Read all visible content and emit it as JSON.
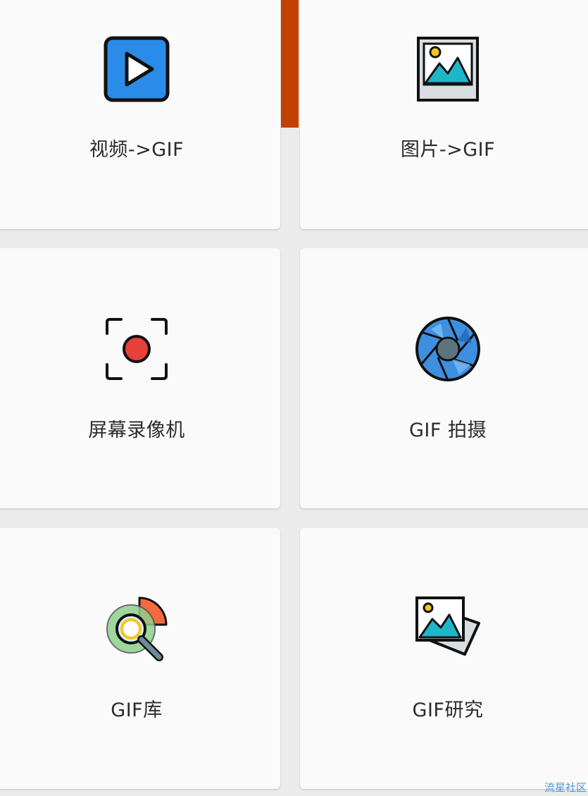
{
  "tiles": [
    {
      "label": "视频->GIF",
      "icon": "play-video-icon"
    },
    {
      "label": "图片->GIF",
      "icon": "picture-icon"
    },
    {
      "label": "屏幕录像机",
      "icon": "screen-record-icon"
    },
    {
      "label": "GIF 拍摄",
      "icon": "camera-aperture-icon"
    },
    {
      "label": "GIF库",
      "icon": "search-chart-icon"
    },
    {
      "label": "GIF研究",
      "icon": "photo-stack-icon"
    }
  ],
  "watermark": "流星社区",
  "colors": {
    "scroll_thumb": "#c24000",
    "tile_bg": "#fafafa",
    "page_bg": "#ececec",
    "play_blue": "#2b8be8",
    "record_red": "#e8403a",
    "aperture_blue": "#3f8fe0"
  }
}
